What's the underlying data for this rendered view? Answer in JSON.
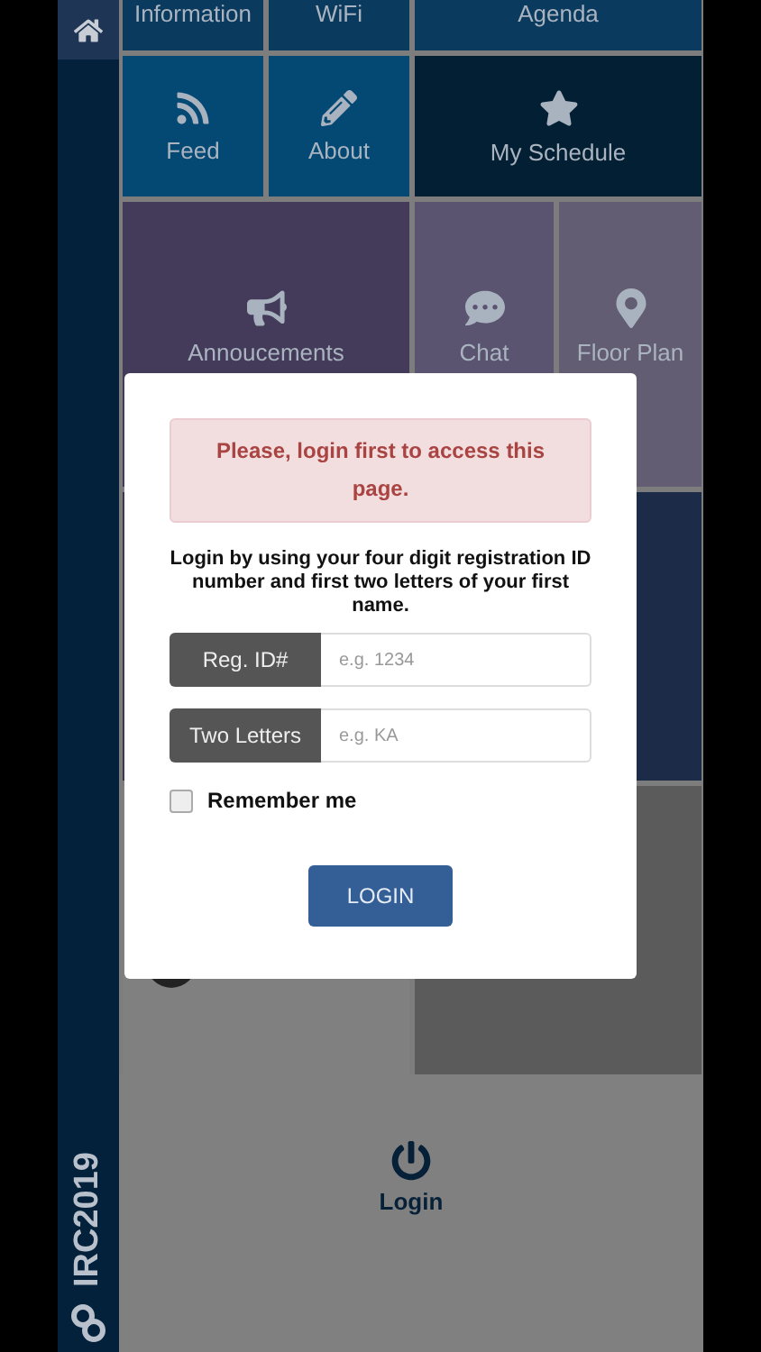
{
  "sidebar": {
    "brand": "IRC2019"
  },
  "tiles": [
    {
      "kind": "plain",
      "label": "Information",
      "color": "#0a3a5e"
    },
    {
      "kind": "plain",
      "label": "WiFi",
      "color": "#0a3a5e"
    },
    {
      "kind": "plain",
      "label": "Agenda",
      "color": "#0a3a5e"
    },
    {
      "kind": "feed",
      "label": "Feed",
      "color": "#044874"
    },
    {
      "kind": "about",
      "label": "About",
      "color": "#044874"
    },
    {
      "kind": "star",
      "label": "My Schedule",
      "color": "#031f33"
    },
    {
      "kind": "megaphone",
      "label": "Annoucements",
      "color": "#443b5b"
    },
    {
      "kind": "chat",
      "label": "Chat",
      "color": "#5b5470"
    },
    {
      "kind": "pin",
      "label": "Floor Plan",
      "color": "#635d73"
    },
    {
      "kind": "blank",
      "color": "#3a3a4a"
    },
    {
      "kind": "blank",
      "color": "#1c2b47"
    },
    {
      "kind": "circle",
      "color": "#808080"
    },
    {
      "kind": "blank",
      "color": "#5b5b5b"
    }
  ],
  "login_link": {
    "label": "Login"
  },
  "modal": {
    "alert": "Please, login first to access this page.",
    "instructions": "Login by using your four digit registration ID number and first two letters of your first name.",
    "fields": [
      {
        "label": "Reg. ID#",
        "placeholder": "e.g. 1234"
      },
      {
        "label": "Two Letters",
        "placeholder": "e.g. KA"
      }
    ],
    "remember": {
      "label": "Remember me",
      "checked": false
    },
    "button": "LOGIN"
  }
}
